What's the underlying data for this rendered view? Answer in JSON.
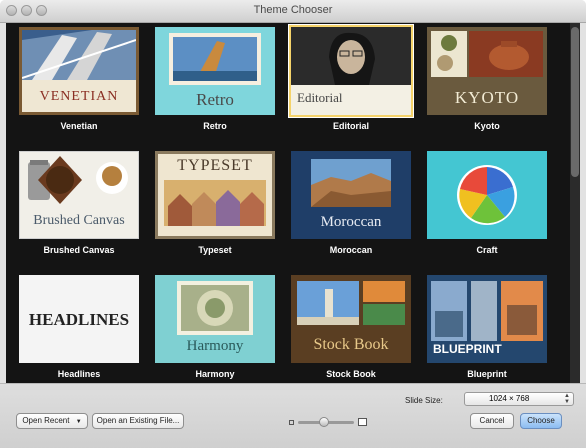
{
  "window": {
    "title": "Theme Chooser"
  },
  "themes": [
    {
      "name": "Venetian",
      "thumb_title": "VENETIAN",
      "selected": false
    },
    {
      "name": "Retro",
      "thumb_title": "Retro",
      "selected": false
    },
    {
      "name": "Editorial",
      "thumb_title": "Editorial",
      "selected": true
    },
    {
      "name": "Kyoto",
      "thumb_title": "KYOTO",
      "selected": false
    },
    {
      "name": "Brushed Canvas",
      "thumb_title": "Brushed Canvas",
      "selected": false
    },
    {
      "name": "Typeset",
      "thumb_title": "TYPESET",
      "selected": false
    },
    {
      "name": "Moroccan",
      "thumb_title": "Moroccan",
      "selected": false
    },
    {
      "name": "Craft",
      "thumb_title": "",
      "selected": false
    },
    {
      "name": "Headlines",
      "thumb_title": "HEADLINES",
      "selected": false
    },
    {
      "name": "Harmony",
      "thumb_title": "Harmony",
      "selected": false
    },
    {
      "name": "Stock Book",
      "thumb_title": "Stock Book",
      "selected": false
    },
    {
      "name": "Blueprint",
      "thumb_title": "BLUEPRINT",
      "selected": false
    }
  ],
  "slide_size": {
    "label": "Slide Size:",
    "value": "1024 × 768"
  },
  "buttons": {
    "open_recent": "Open Recent",
    "open_existing": "Open an Existing File...",
    "cancel": "Cancel",
    "choose": "Choose"
  },
  "colors": {
    "gallery_bg": "#141414",
    "selection": "#f5d36a",
    "default_button": "#8cbcf1"
  },
  "icons": [
    "close-icon",
    "minimize-icon",
    "zoom-icon",
    "dropdown-arrow-icon",
    "select-arrows-icon",
    "zoom-small-icon",
    "zoom-large-icon"
  ]
}
